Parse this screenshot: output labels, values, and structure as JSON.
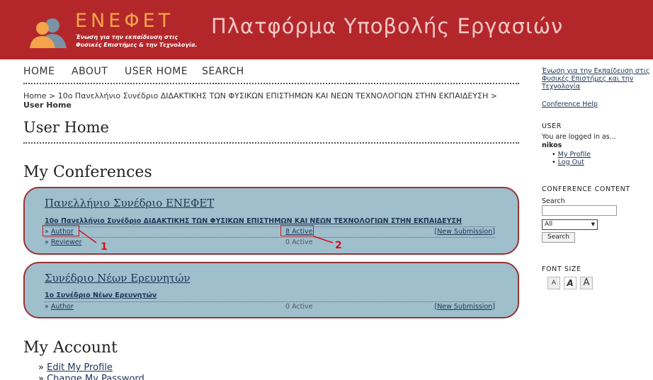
{
  "header": {
    "logo_name": "ΕΝΕΦΕΤ",
    "logo_tagline_1": "Ένωση για την εκπαίδευση στις",
    "logo_tagline_2": "Φυσικές Επιστήμες & την Τεχνολογία.",
    "platform_title": "Πλατφόρμα  Υποβολής Εργασιών",
    "brand_color": "#b3272b",
    "logo_color": "#f3a44a"
  },
  "nav": {
    "home": "HOME",
    "about": "ABOUT",
    "user_home": "USER HOME",
    "search": "SEARCH"
  },
  "breadcrumb": {
    "home": "Home",
    "sep": " > ",
    "conference": "10ο Πανελλήνιο Συνέδριο ΔΙΔΑΚΤΙΚΗΣ ΤΩΝ ΦΥΣΙΚΩΝ ΕΠΙΣΤΗΜΩΝ ΚΑΙ ΝΕΩΝ ΤΕΧΝΟΛΟΓΙΩΝ ΣΤΗΝ ΕΚΠΑΙΔΕΥΣΗ",
    "current": "User Home"
  },
  "page_title": "User Home",
  "my_conferences": {
    "heading": "My Conferences",
    "conferences": [
      {
        "title": "Πανελλήνιο Συνέδριο ΕΝΕΦΕΤ",
        "schedule": "10ο Πανελλήνιο Συνέδριο ΔΙΔΑΚΤΙΚΗΣ ΤΩΝ ΦΥΣΙΚΩΝ ΕΠΙΣΤΗΜΩΝ ΚΑΙ ΝΕΩΝ ΤΕΧΝΟΛΟΓΙΩΝ ΣΤΗΝ ΕΚΠΑΙΔΕΥΣΗ",
        "roles": [
          {
            "bullet": "»",
            "name": "Author",
            "count": "8 Active",
            "new_submission": "New Submission"
          },
          {
            "bullet": "»",
            "name": "Reviewer",
            "count": "0 Active"
          }
        ]
      },
      {
        "title": "Συνέδριο Νέων Ερευνητών",
        "schedule": "1ο Συνέδριο Νέων Ερευνητών",
        "roles": [
          {
            "bullet": "»",
            "name": "Author",
            "count": "0 Active",
            "new_submission": "New Submission"
          }
        ]
      }
    ]
  },
  "annotations": {
    "mark_1": "1",
    "mark_2": "2",
    "color": "#d4101a"
  },
  "my_account": {
    "heading": "My Account",
    "bullet": "»",
    "links": [
      "Edit My Profile",
      "Change My Password"
    ]
  },
  "sidebar": {
    "org_link": "Ένωση για την Εκπαίδευση στις Φυσικές Επιστήμες και την Τεχνολογία",
    "conference_help": "Conference Help",
    "user_heading": "USER",
    "logged_in_as": "You are logged in as...",
    "username": "nikos",
    "user_links": [
      "My Profile",
      "Log Out"
    ],
    "conference_content_heading": "CONFERENCE CONTENT",
    "search_label": "Search",
    "search_value": "",
    "search_scope": "All",
    "search_button": "Search",
    "font_size_heading": "FONT SIZE",
    "font_small": "A",
    "font_medium": "A",
    "font_large": "A"
  }
}
